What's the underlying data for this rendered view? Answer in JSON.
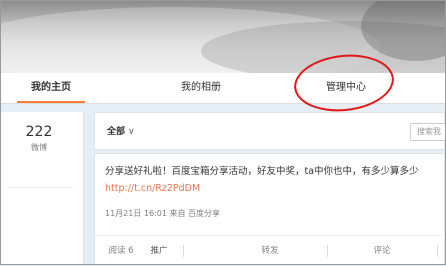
{
  "nav": {
    "tabs": [
      {
        "label": "我的主页",
        "active": true
      },
      {
        "label": "我的相册",
        "active": false
      },
      {
        "label": "管理中心",
        "active": false
      }
    ]
  },
  "sidebar": {
    "count": "222",
    "count_label": "微博"
  },
  "feed": {
    "filter_label": "全部",
    "search_placeholder": "搜索我"
  },
  "post": {
    "text": "分享送好礼啦！百度宝箱分享活动，好友中奖，ta中你也中，有多少算多少",
    "link": "http://t.cn/Rz2PdDM",
    "time": "11月21日 16:01",
    "source_prefix": "来自",
    "source": "百度分享",
    "actions": {
      "read": "阅读 6",
      "promote": "推广",
      "forward": "转发",
      "comment": "评论"
    }
  },
  "colors": {
    "accent": "#fa7d3c",
    "link": "#eb7350",
    "highlight_circle": "#e21818"
  }
}
